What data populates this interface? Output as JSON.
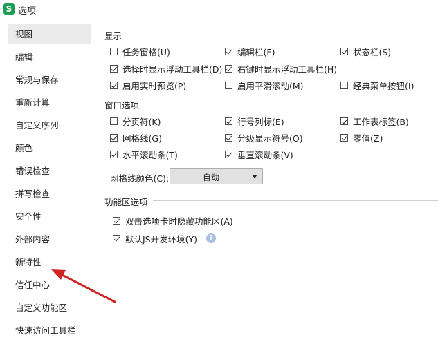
{
  "window": {
    "app_icon_letter": "S",
    "title": "选项"
  },
  "sidebar": {
    "items": [
      {
        "label": "视图"
      },
      {
        "label": "编辑"
      },
      {
        "label": "常规与保存"
      },
      {
        "label": "重新计算"
      },
      {
        "label": "自定义序列"
      },
      {
        "label": "颜色"
      },
      {
        "label": "错误检查"
      },
      {
        "label": "拼写检查"
      },
      {
        "label": "安全性"
      },
      {
        "label": "外部内容"
      },
      {
        "label": "新特性"
      },
      {
        "label": "信任中心"
      },
      {
        "label": "自定义功能区"
      },
      {
        "label": "快速访问工具栏"
      }
    ],
    "selected": "视图"
  },
  "display": {
    "title": "显示",
    "options": [
      {
        "label": "任务窗格(U)",
        "checked": false
      },
      {
        "label": "编辑栏(F)",
        "checked": true
      },
      {
        "label": "状态栏(S)",
        "checked": true
      },
      {
        "label": "选择时显示浮动工具栏(D)",
        "checked": true
      },
      {
        "label": "右键时显示浮动工具栏(H)",
        "checked": true
      },
      {
        "label": "启用实时预览(P)",
        "checked": true
      },
      {
        "label": "启用平滑滚动(M)",
        "checked": false
      },
      {
        "label": "经典菜单按钮(I)",
        "checked": false
      }
    ]
  },
  "window_options": {
    "title": "窗口选项",
    "options": [
      {
        "label": "分页符(K)",
        "checked": false
      },
      {
        "label": "行号列标(E)",
        "checked": true
      },
      {
        "label": "工作表标签(B)",
        "checked": true
      },
      {
        "label": "网格线(G)",
        "checked": true
      },
      {
        "label": "分级显示符号(O)",
        "checked": true
      },
      {
        "label": "零值(Z)",
        "checked": true
      },
      {
        "label": "水平滚动条(T)",
        "checked": true
      },
      {
        "label": "垂直滚动条(V)",
        "checked": true
      }
    ],
    "grid_color_label": "网格线颜色(C):",
    "grid_color_value": "自动"
  },
  "ribbon_options": {
    "title": "功能区选项",
    "options": [
      {
        "label": "双击选项卡时隐藏功能区(A)",
        "checked": true
      },
      {
        "label": "默认JS开发环境(Y)",
        "checked": true
      }
    ]
  },
  "colors": {
    "annotation_arrow": "#d02424",
    "selected_nav_bg": "#eaeaea",
    "app_icon": "#1f9d55"
  }
}
